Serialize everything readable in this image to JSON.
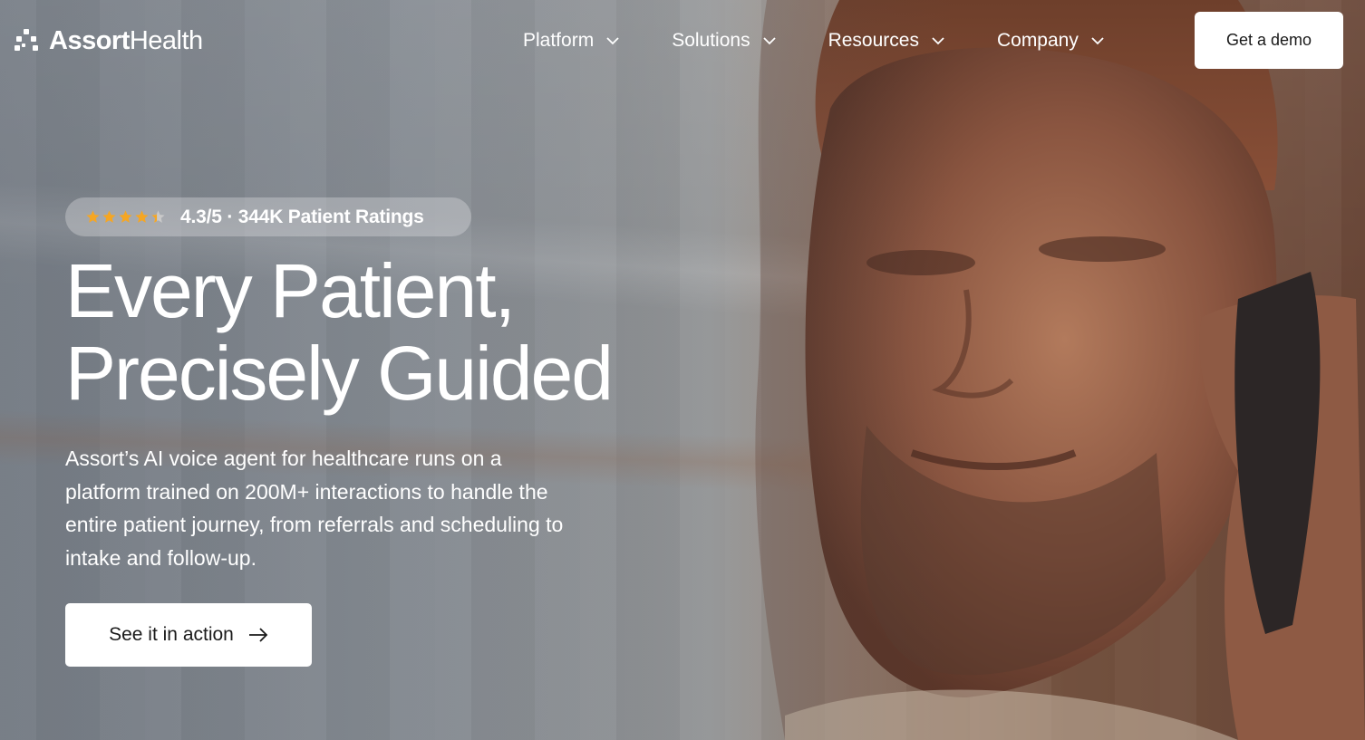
{
  "brand": {
    "name_bold": "Assort",
    "name_light": "Health"
  },
  "nav": {
    "items": [
      {
        "label": "Platform"
      },
      {
        "label": "Solutions"
      },
      {
        "label": "Resources"
      },
      {
        "label": "Company"
      }
    ],
    "demo_label": "Get a demo"
  },
  "hero": {
    "rating": {
      "text": "4.3/5 · 344K  Patient Ratings",
      "stars": 4.3,
      "star_color": "#f5a623"
    },
    "headline_line1": "Every Patient,",
    "headline_line2": "Precisely Guided",
    "description": "Assort’s AI voice agent for healthcare runs on a platform trained on 200M+ interactions to handle the entire patient journey, from referrals and scheduling to intake and follow-up.",
    "cta_label": "See it in action"
  }
}
